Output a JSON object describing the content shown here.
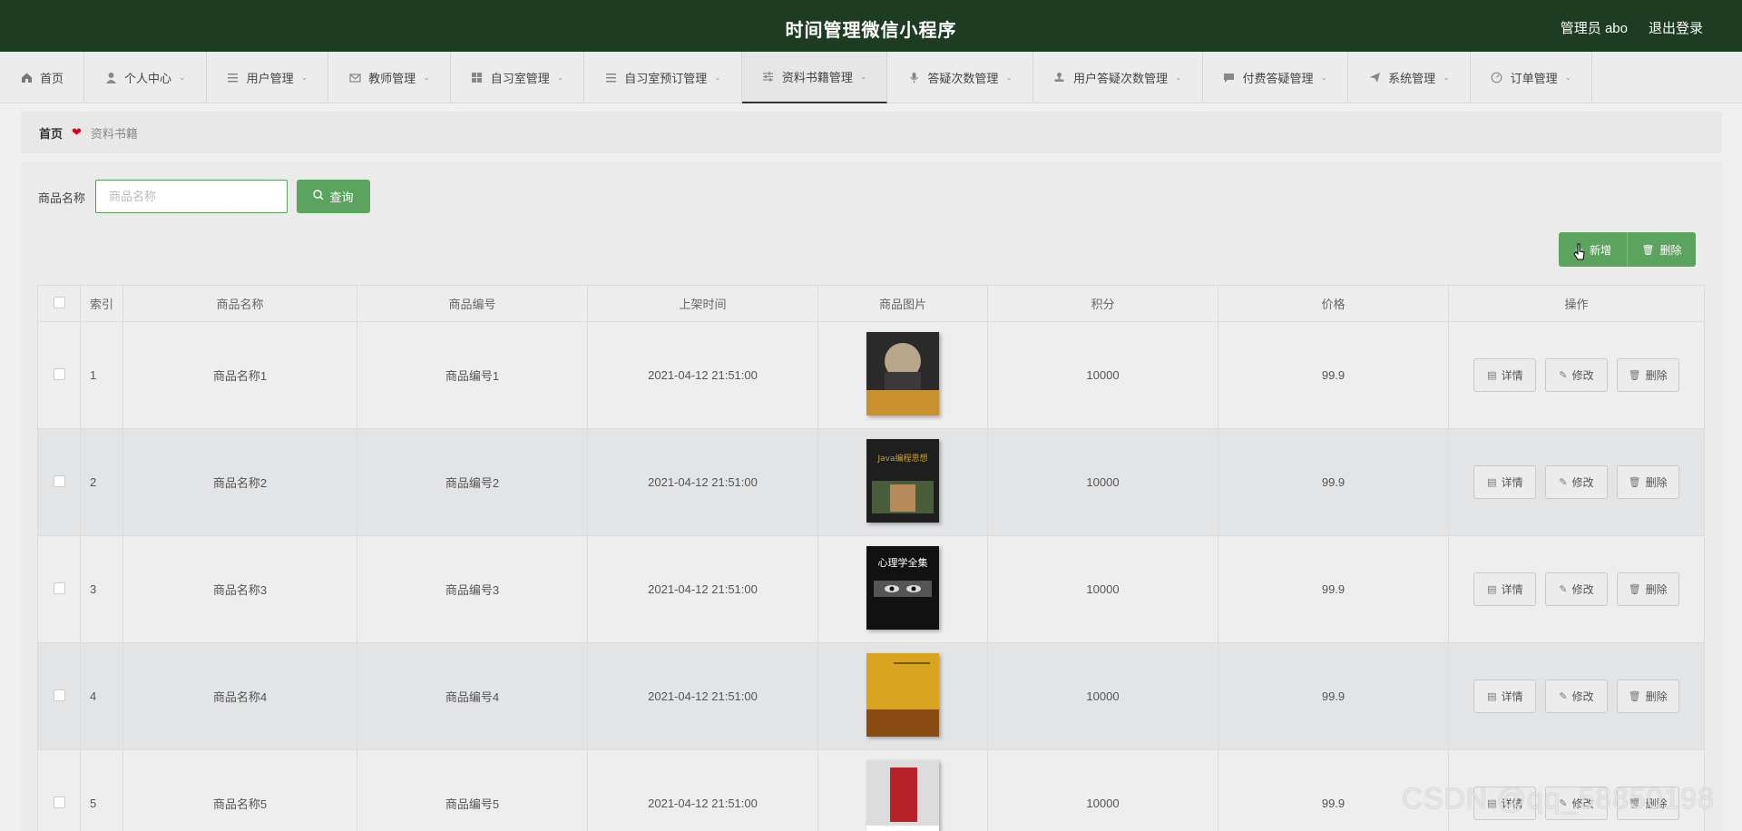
{
  "header": {
    "title": "时间管理微信小程序",
    "user": "管理员 abo",
    "logout": "退出登录"
  },
  "nav": [
    {
      "label": "首页",
      "icon": "home-icon",
      "chevron": false
    },
    {
      "label": "个人中心",
      "icon": "person-icon",
      "chevron": true
    },
    {
      "label": "用户管理",
      "icon": "list-icon",
      "chevron": true
    },
    {
      "label": "教师管理",
      "icon": "mail-icon",
      "chevron": true
    },
    {
      "label": "自习室管理",
      "icon": "grid-icon",
      "chevron": true
    },
    {
      "label": "自习室预订管理",
      "icon": "list-icon",
      "chevron": true
    },
    {
      "label": "资料书籍管理",
      "icon": "sliders-icon",
      "chevron": true
    },
    {
      "label": "答疑次数管理",
      "icon": "mic-icon",
      "chevron": true
    },
    {
      "label": "用户答疑次数管理",
      "icon": "stamp-icon",
      "chevron": true
    },
    {
      "label": "付费答疑管理",
      "icon": "chat-icon",
      "chevron": true
    },
    {
      "label": "系统管理",
      "icon": "send-icon",
      "chevron": true
    },
    {
      "label": "订单管理",
      "icon": "gauge-icon",
      "chevron": true
    }
  ],
  "breadcrumb": {
    "home": "首页",
    "current": "资料书籍"
  },
  "search": {
    "label": "商品名称",
    "placeholder": "商品名称",
    "button": "查询"
  },
  "actions": {
    "add": "新增",
    "delete": "删除"
  },
  "table": {
    "headers": [
      "索引",
      "商品名称",
      "商品编号",
      "上架时间",
      "商品图片",
      "积分",
      "价格",
      "操作"
    ],
    "rows": [
      {
        "index": "1",
        "name": "商品名称1",
        "code": "商品编号1",
        "time": "2021-04-12 21:51:00",
        "points": "10000",
        "price": "99.9",
        "cover_title": "",
        "cover_bg": "#2a2a2a",
        "cover_accent": "#c8912e"
      },
      {
        "index": "2",
        "name": "商品名称2",
        "code": "商品编号2",
        "time": "2021-04-12 21:51:00",
        "points": "10000",
        "price": "99.9",
        "cover_title": "Java编程思想",
        "cover_bg": "#1e1e1e",
        "cover_accent": "#c9a531"
      },
      {
        "index": "3",
        "name": "商品名称3",
        "code": "商品编号3",
        "time": "2021-04-12 21:51:00",
        "points": "10000",
        "price": "99.9",
        "cover_title": "心理学全集",
        "cover_bg": "#111111",
        "cover_accent": "#ffffff"
      },
      {
        "index": "4",
        "name": "商品名称4",
        "code": "商品编号4",
        "time": "2021-04-12 21:51:00",
        "points": "10000",
        "price": "99.9",
        "cover_title": "",
        "cover_bg": "#d9a520",
        "cover_accent": "#8a4b12"
      },
      {
        "index": "5",
        "name": "商品名称5",
        "code": "商品编号5",
        "time": "2021-04-12 21:51:00",
        "points": "10000",
        "price": "99.9",
        "cover_title": "",
        "cover_bg": "#dcdcdc",
        "cover_accent": "#b8222a"
      }
    ],
    "ops": {
      "detail": "详情",
      "edit": "修改",
      "delete": "删除"
    }
  },
  "watermark": "CSDN @qq_58850198",
  "colors": {
    "header_bg": "#1d3c22",
    "primary": "#5ba35e"
  }
}
